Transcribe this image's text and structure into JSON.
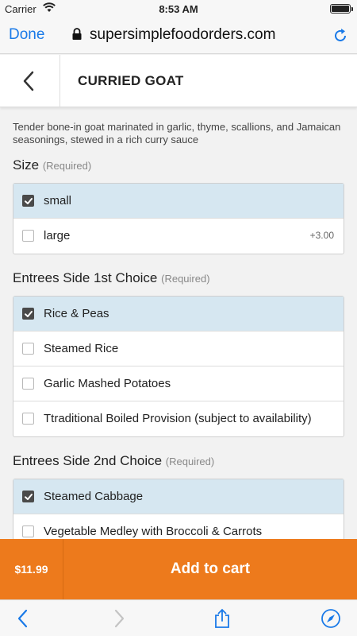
{
  "status_bar": {
    "carrier": "Carrier",
    "time": "8:53 AM"
  },
  "browser": {
    "done_label": "Done",
    "url": "supersimplefoodorders.com",
    "icons": [
      "lock-icon",
      "reload-icon"
    ]
  },
  "header": {
    "title": "CURRIED GOAT"
  },
  "item": {
    "description": "Tender bone-in goat marinated in garlic, thyme, scallions, and Jamaican seasonings, stewed in a rich curry sauce"
  },
  "groups": [
    {
      "title": "Size",
      "required": "(Required)",
      "options": [
        {
          "label": "small",
          "selected": true,
          "price": ""
        },
        {
          "label": "large",
          "selected": false,
          "price": "+3.00"
        }
      ]
    },
    {
      "title": "Entrees Side 1st Choice",
      "required": "(Required)",
      "options": [
        {
          "label": "Rice & Peas",
          "selected": true,
          "price": ""
        },
        {
          "label": "Steamed Rice",
          "selected": false,
          "price": ""
        },
        {
          "label": "Garlic Mashed Potatoes",
          "selected": false,
          "price": ""
        },
        {
          "label": "Ttraditional Boiled Provision (subject to availability)",
          "selected": false,
          "price": ""
        }
      ]
    },
    {
      "title": "Entrees Side 2nd Choice",
      "required": "(Required)",
      "options": [
        {
          "label": "Steamed Cabbage",
          "selected": true,
          "price": ""
        },
        {
          "label": "Vegetable Medley with Broccoli & Carrots",
          "selected": false,
          "price": ""
        }
      ]
    }
  ],
  "cart": {
    "total": "$11.99",
    "add_label": "Add to cart"
  },
  "colors": {
    "accent": "#1a7ae8",
    "cart": "#ed7a1c",
    "selected_row": "#d6e7f1"
  },
  "toolbar_icons": [
    "back-icon",
    "forward-icon",
    "share-icon",
    "compass-icon"
  ]
}
